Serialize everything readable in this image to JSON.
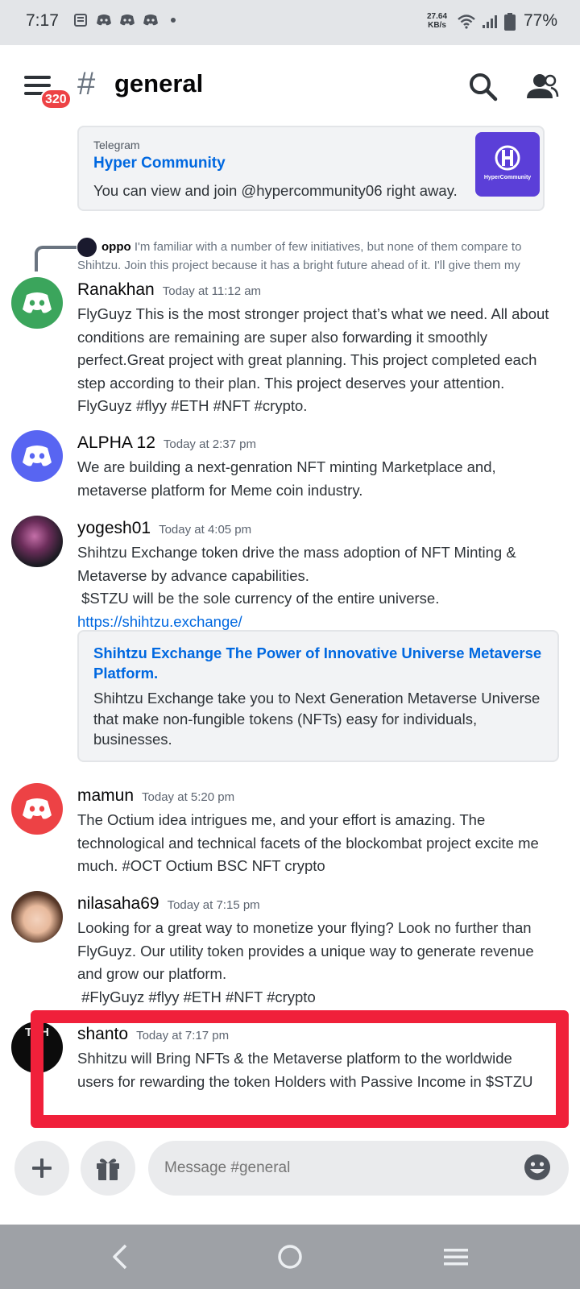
{
  "status_bar": {
    "time": "7:17",
    "net_speed_value": "27.64",
    "net_speed_unit": "KB/s",
    "battery": "77%"
  },
  "header": {
    "notification_count": "320",
    "channel_name": "general"
  },
  "telegram_embed": {
    "provider": "Telegram",
    "title": "Hyper Community",
    "description": "You can view and join @hypercommunity06 right away.",
    "thumbnail_text": "HyperCommunity"
  },
  "reply": {
    "author": "oppo",
    "text_line1": "I'm familiar with a number of few initiatives, but none of them compare to",
    "text_line2": "Shihtzu. Join this project because it has a bright future ahead of it. I'll give them my"
  },
  "messages": [
    {
      "author": "Ranakhan",
      "timestamp": "Today at 11:12 am",
      "lines": [
        "FlyGuyz This is the most stronger project that’s what we need. All about",
        "conditions are remaining are super also forwarding it smoothly",
        "perfect.Great project with great planning. This project completed each",
        "step according to their plan. This project deserves your attention.",
        "FlyGuyz #flyy #ETH #NFT #crypto."
      ]
    },
    {
      "author": "ALPHA 12",
      "timestamp": "Today at 2:37 pm",
      "lines": [
        "We are building a next-genration NFT minting Marketplace and,",
        "metaverse platform for Meme coin industry."
      ]
    },
    {
      "author": "yogesh01",
      "timestamp": "Today at 4:05 pm",
      "lines": [
        "Shihtzu Exchange token drive the mass adoption of NFT Minting &",
        "Metaverse by advance capabilities.",
        " $STZU will be the sole currency of the entire universe."
      ],
      "link": "https://shihtzu.exchange/",
      "embed": {
        "title_line1": "Shihtzu Exchange The Power of Innovative Universe Metaverse",
        "title_line2": "Platform.",
        "desc_line1": "Shihtzu Exchange take you to Next Generation Metaverse Universe",
        "desc_line2": "that make non-fungible tokens (NFTs) easy for individuals,",
        "desc_line3": "businesses."
      }
    },
    {
      "author": "mamun",
      "timestamp": "Today at 5:20 pm",
      "lines": [
        "The Octium idea intrigues me, and your effort is amazing. The",
        "technological and technical facets of the blockombat project excite me",
        "much. #OCT Octium BSC NFT crypto"
      ]
    },
    {
      "author": "nilasaha69",
      "timestamp": "Today at 7:15 pm",
      "lines": [
        "Looking for a great way to monetize your flying? Look no further than",
        "FlyGuyz. Our utility token provides a unique way to generate revenue",
        "and grow our platform.",
        " #FlyGuyz #flyy #ETH #NFT #crypto"
      ]
    },
    {
      "author": "shanto",
      "timestamp": "Today at 7:17 pm",
      "avatar_text": "TPH",
      "lines": [
        "Shhitzu will Bring NFTs & the Metaverse platform to the worldwide",
        "users for rewarding the token Holders with Passive Income in $STZU"
      ]
    }
  ],
  "input": {
    "placeholder": "Message #general"
  },
  "colors": {
    "discord_green": "#3ba55c",
    "discord_blurple": "#5865f2",
    "discord_red": "#ed4245",
    "link_blue": "#0068e0",
    "highlight_red": "#f0203a"
  }
}
